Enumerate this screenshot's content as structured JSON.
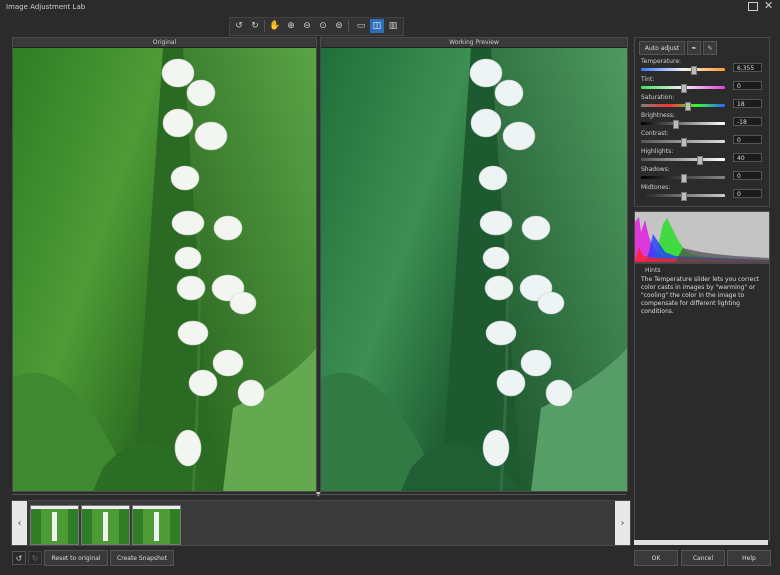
{
  "window": {
    "title": "Image Adjustment Lab"
  },
  "toolbar": {
    "tools": [
      {
        "name": "rotate-left-icon",
        "glyph": "↺"
      },
      {
        "name": "rotate-right-icon",
        "glyph": "↻"
      },
      {
        "name": "pan-hand-icon",
        "glyph": "✋"
      },
      {
        "name": "zoom-in-icon",
        "glyph": "⊕"
      },
      {
        "name": "zoom-out-icon",
        "glyph": "⊖"
      },
      {
        "name": "zoom-fit-icon",
        "glyph": "⊙"
      },
      {
        "name": "zoom-actual-icon",
        "glyph": "⊚"
      },
      {
        "name": "single-view-icon",
        "glyph": "▭"
      },
      {
        "name": "split-view-icon",
        "glyph": "◫"
      },
      {
        "name": "side-by-side-icon",
        "glyph": "▥"
      }
    ]
  },
  "panes": {
    "original_label": "Original",
    "preview_label": "Working Preview"
  },
  "adjust": {
    "auto_adjust_label": "Auto adjust",
    "sliders": [
      {
        "key": "temperature",
        "label": "Temperature:",
        "value": "6,355",
        "pos": 0.62
      },
      {
        "key": "tint",
        "label": "Tint:",
        "value": "0",
        "pos": 0.5
      },
      {
        "key": "saturation",
        "label": "Saturation:",
        "value": "18",
        "pos": 0.55
      },
      {
        "key": "brightness",
        "label": "Brightness:",
        "value": "-18",
        "pos": 0.4
      },
      {
        "key": "contrast",
        "label": "Contrast:",
        "value": "0",
        "pos": 0.5
      },
      {
        "key": "highlights",
        "label": "Highlights:",
        "value": "40",
        "pos": 0.7
      },
      {
        "key": "shadows",
        "label": "Shadows:",
        "value": "0",
        "pos": 0.5
      },
      {
        "key": "midtones",
        "label": "Midtones:",
        "value": "0",
        "pos": 0.5
      }
    ]
  },
  "hints": {
    "title": "Hints",
    "text": "The Temperature slider lets you correct color casts in images by \"warming\" or \"cooling\" the color in the image to compensate for different lighting conditions."
  },
  "bottom": {
    "reset_label": "Reset to original",
    "snapshot_label": "Create Snapshot",
    "ok_label": "OK",
    "cancel_label": "Cancel",
    "help_label": "Help"
  }
}
